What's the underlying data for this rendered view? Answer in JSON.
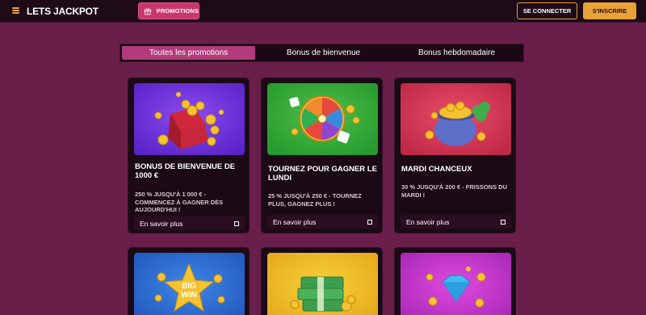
{
  "header": {
    "logo": "LETS JACKPOT",
    "promotions_label": "PROMOTIONS",
    "login_label": "SE CONNECTER",
    "signup_label": "S'INSCRIRE"
  },
  "tabs": [
    {
      "label": "Toutes les promotions",
      "active": true
    },
    {
      "label": "Bonus de bienvenue",
      "active": false
    },
    {
      "label": "Bonus hebdomadaire",
      "active": false
    }
  ],
  "cards": [
    {
      "title": "BONUS DE BIENVENUE DE 1000 €",
      "desc": "250 % JUSQU'À 1 000 € - COMMENCEZ À GAGNER DÈS AUJOURD'HUI !",
      "more": "En savoir plus",
      "image": "gift-box-coins"
    },
    {
      "title": "TOURNEZ POUR GAGNER LE LUNDI",
      "desc": "25 % JUSQU'À 250 € - TOURNEZ PLUS, GAGNEZ PLUS !",
      "more": "En savoir plus",
      "image": "prize-wheel"
    },
    {
      "title": "MARDI CHANCEUX",
      "desc": "30 % JUSQU'À 200 € - FRISSONS DU MARDI !",
      "more": "En savoir plus",
      "image": "pot-of-gold"
    },
    {
      "title": "",
      "desc": "",
      "more": "",
      "image": "big-win-star"
    },
    {
      "title": "",
      "desc": "",
      "more": "",
      "image": "money-stack"
    },
    {
      "title": "",
      "desc": "",
      "more": "",
      "image": "diamond"
    }
  ],
  "colors": {
    "background": "#6a1e4a",
    "topbar": "#1f0a18",
    "accent_gold": "#e8a235",
    "accent_pink": "#c8376d",
    "card_bg": "#1b0a16"
  }
}
